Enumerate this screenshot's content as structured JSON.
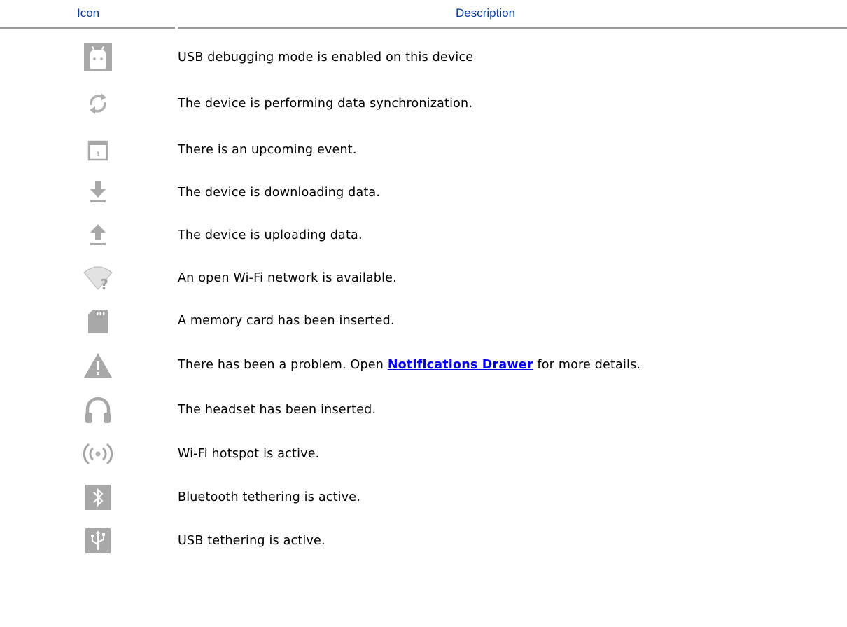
{
  "table": {
    "header": {
      "icon": "Icon",
      "description": "Description",
      "header_color": "#0a3a9a"
    },
    "rows": [
      {
        "icon": "android-debug-icon",
        "description": "USB debugging mode is enabled on this device"
      },
      {
        "icon": "sync-icon",
        "description": "The device is performing data synchronization."
      },
      {
        "icon": "calendar-icon",
        "description": "There is an upcoming event."
      },
      {
        "icon": "download-icon",
        "description": "The device is downloading data."
      },
      {
        "icon": "upload-icon",
        "description": "The device is uploading data."
      },
      {
        "icon": "wifi-open-network-icon",
        "description": "An open Wi-Fi network is available."
      },
      {
        "icon": "memory-card-icon",
        "description": "A memory card has been inserted."
      },
      {
        "icon": "warning-icon",
        "description_before": "There has been a problem. Open ",
        "link_text": "Notifications Drawer",
        "description_after": " for more details."
      },
      {
        "icon": "headset-icon",
        "description": "The headset has been inserted."
      },
      {
        "icon": "wifi-hotspot-icon",
        "description": "Wi-Fi hotspot is active."
      },
      {
        "icon": "bluetooth-tethering-icon",
        "description": "Bluetooth tethering is active."
      },
      {
        "icon": "usb-tethering-icon",
        "description": "USB tethering is active."
      }
    ]
  },
  "colors": {
    "icon_gray": "#a8a8a8",
    "link": "#0000ee"
  }
}
